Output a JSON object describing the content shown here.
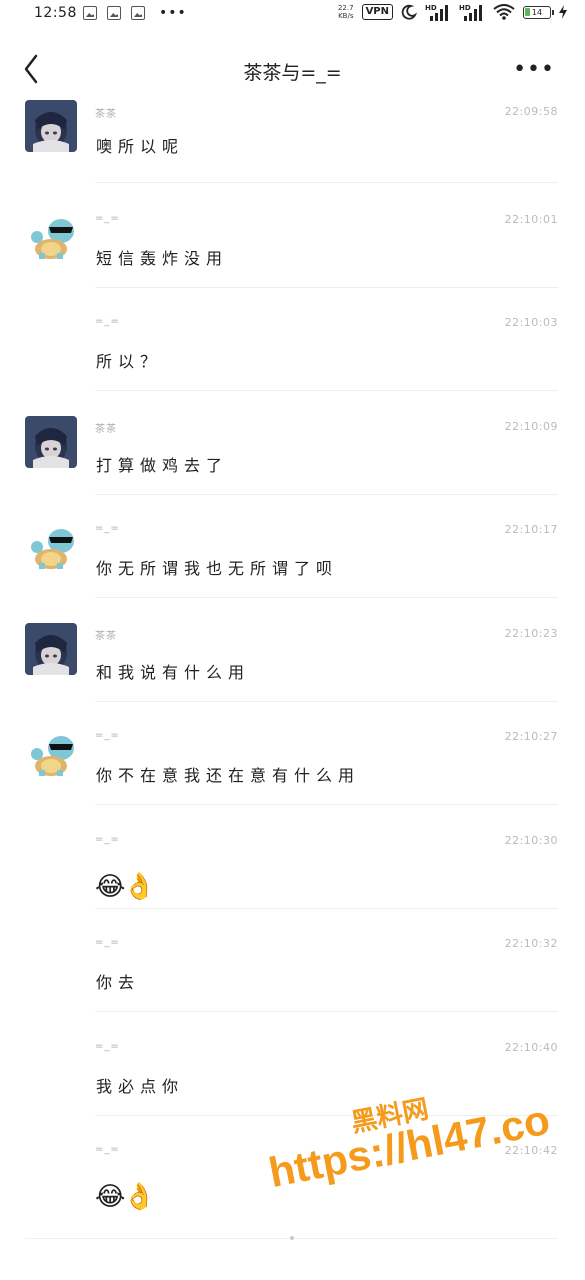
{
  "status_bar": {
    "time": "12:58",
    "speed_value": "22.7",
    "speed_unit": "KB/s",
    "vpn_label": "VPN",
    "battery_level": "14",
    "overflow": "•••"
  },
  "header": {
    "title": "茶茶与=_=",
    "more": "•••"
  },
  "messages": [
    {
      "sender": "茶茶",
      "time": "22:09:58",
      "text": "噢所以呢",
      "avatar": "girl"
    },
    {
      "sender": "=_=",
      "time": "22:10:01",
      "text": "短信轰炸没用",
      "avatar": "squirtle"
    },
    {
      "sender": "=_=",
      "time": "22:10:03",
      "text": "所以？",
      "avatar": ""
    },
    {
      "sender": "茶茶",
      "time": "22:10:09",
      "text": "打算做鸡去了",
      "avatar": "girl"
    },
    {
      "sender": "=_=",
      "time": "22:10:17",
      "text": "你无所谓我也无所谓了呗",
      "avatar": "squirtle"
    },
    {
      "sender": "茶茶",
      "time": "22:10:23",
      "text": "和我说有什么用",
      "avatar": "girl"
    },
    {
      "sender": "=_=",
      "time": "22:10:27",
      "text": "你不在意我还在意有什么用",
      "avatar": "squirtle"
    },
    {
      "sender": "=_=",
      "time": "22:10:30",
      "text": "😂👌",
      "avatar": ""
    },
    {
      "sender": "=_=",
      "time": "22:10:32",
      "text": "你去",
      "avatar": ""
    },
    {
      "sender": "=_=",
      "time": "22:10:40",
      "text": "我必点你",
      "avatar": ""
    },
    {
      "sender": "=_=",
      "time": "22:10:42",
      "text": "😂👌",
      "avatar": ""
    }
  ],
  "watermark": {
    "cn": "黑料网",
    "url": "https://hl47.co"
  },
  "colors": {
    "watermark": "#f59a1a",
    "timestamp": "#bbbbbb",
    "divider": "#eeeeee"
  }
}
